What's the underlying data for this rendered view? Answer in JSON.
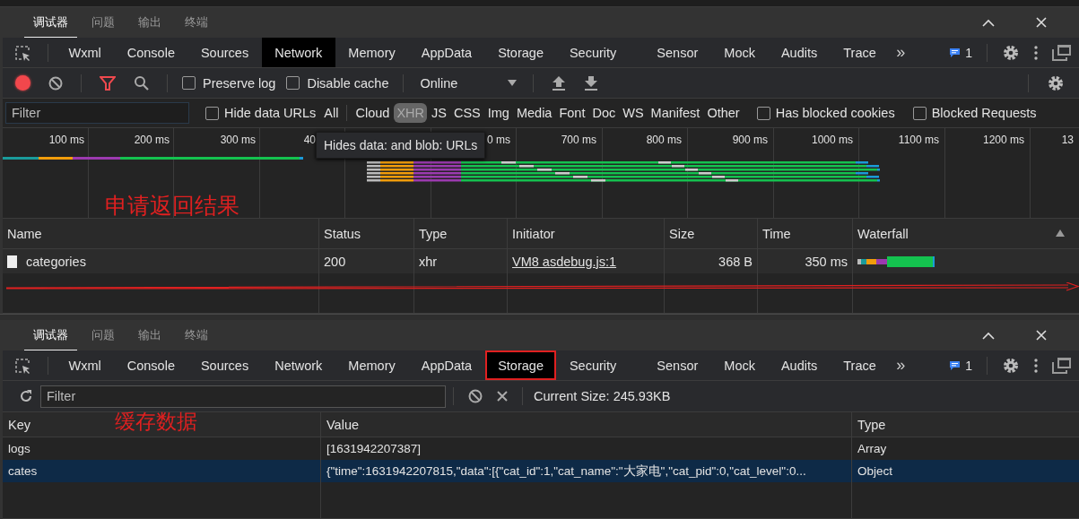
{
  "network_panel": {
    "drawer_tabs": [
      {
        "label": "调试器",
        "selected": true
      },
      {
        "label": "问题",
        "selected": false
      },
      {
        "label": "输出",
        "selected": false
      },
      {
        "label": "终端",
        "selected": false
      }
    ],
    "main_tabs": [
      {
        "label": "Wxml",
        "selected": false
      },
      {
        "label": "Console",
        "selected": false
      },
      {
        "label": "Sources",
        "selected": false
      },
      {
        "label": "Network",
        "selected": true
      },
      {
        "label": "Memory",
        "selected": false
      },
      {
        "label": "AppData",
        "selected": false
      },
      {
        "label": "Storage",
        "selected": false
      },
      {
        "label": "Security",
        "selected": false
      },
      {
        "label": "Sensor",
        "selected": false
      },
      {
        "label": "Mock",
        "selected": false
      },
      {
        "label": "Audits",
        "selected": false
      },
      {
        "label": "Trace",
        "selected": false
      }
    ],
    "more": "»",
    "message_count": "1",
    "toolbar": {
      "recording": true,
      "preserve_log": {
        "label": "Preserve log",
        "checked": false
      },
      "disable_cache": {
        "label": "Disable cache",
        "checked": false
      },
      "throttling": "Online"
    },
    "filter": {
      "placeholder": "Filter",
      "hide_data_urls": {
        "label": "Hide data URLs",
        "checked": false
      },
      "types": [
        {
          "label": "All",
          "selected": false
        },
        {
          "label": "Cloud",
          "selected": false
        },
        {
          "label": "XHR",
          "selected": true
        },
        {
          "label": "JS",
          "selected": false
        },
        {
          "label": "CSS",
          "selected": false
        },
        {
          "label": "Img",
          "selected": false
        },
        {
          "label": "Media",
          "selected": false
        },
        {
          "label": "Font",
          "selected": false
        },
        {
          "label": "Doc",
          "selected": false
        },
        {
          "label": "WS",
          "selected": false
        },
        {
          "label": "Manifest",
          "selected": false
        },
        {
          "label": "Other",
          "selected": false
        }
      ],
      "has_blocked_cookies": {
        "label": "Has blocked cookies",
        "checked": false
      },
      "blocked_requests": {
        "label": "Blocked Requests",
        "checked": false
      }
    },
    "timeline": {
      "ticks": [
        "100 ms",
        "200 ms",
        "300 ms",
        "40",
        "0 ms",
        "700 ms",
        "800 ms",
        "900 ms",
        "1000 ms",
        "1100 ms",
        "1200 ms",
        "13"
      ],
      "tooltip": "Hides data: and blob: URLs"
    },
    "annotation": "申请返回结果",
    "requests": {
      "columns": [
        "Name",
        "Status",
        "Type",
        "Initiator",
        "Size",
        "Time",
        "Waterfall"
      ],
      "sort_ascending": true,
      "rows": [
        {
          "name": "categories",
          "status": "200",
          "type": "xhr",
          "initiator": "VM8 asdebug.js:1",
          "size": "368 B",
          "time": "350 ms"
        }
      ]
    }
  },
  "storage_panel": {
    "drawer_tabs": [
      {
        "label": "调试器",
        "selected": true
      },
      {
        "label": "问题",
        "selected": false
      },
      {
        "label": "输出",
        "selected": false
      },
      {
        "label": "终端",
        "selected": false
      }
    ],
    "main_tabs": [
      {
        "label": "Wxml",
        "selected": false,
        "boxed": false
      },
      {
        "label": "Console",
        "selected": false,
        "boxed": false
      },
      {
        "label": "Sources",
        "selected": false,
        "boxed": false
      },
      {
        "label": "Network",
        "selected": false,
        "boxed": false
      },
      {
        "label": "Memory",
        "selected": false,
        "boxed": false
      },
      {
        "label": "AppData",
        "selected": false,
        "boxed": false
      },
      {
        "label": "Storage",
        "selected": true,
        "boxed": true
      },
      {
        "label": "Security",
        "selected": false,
        "boxed": false
      },
      {
        "label": "Sensor",
        "selected": false,
        "boxed": false
      },
      {
        "label": "Mock",
        "selected": false,
        "boxed": false
      },
      {
        "label": "Audits",
        "selected": false,
        "boxed": false
      },
      {
        "label": "Trace",
        "selected": false,
        "boxed": false
      }
    ],
    "more": "»",
    "message_count": "1",
    "filter_placeholder": "Filter",
    "annotation": "缓存数据",
    "current_size": "Current Size: 245.93KB",
    "columns": [
      "Key",
      "Value",
      "Type"
    ],
    "rows": [
      {
        "key": "logs",
        "value": "[1631942207387]",
        "type": "Array",
        "selected": false
      },
      {
        "key": "cates",
        "value": "{\"time\":1631942207815,\"data\":[{\"cat_id\":1,\"cat_name\":\"大家电\",\"cat_pid\":0,\"cat_level\":0...",
        "type": "Object",
        "selected": true
      }
    ]
  }
}
